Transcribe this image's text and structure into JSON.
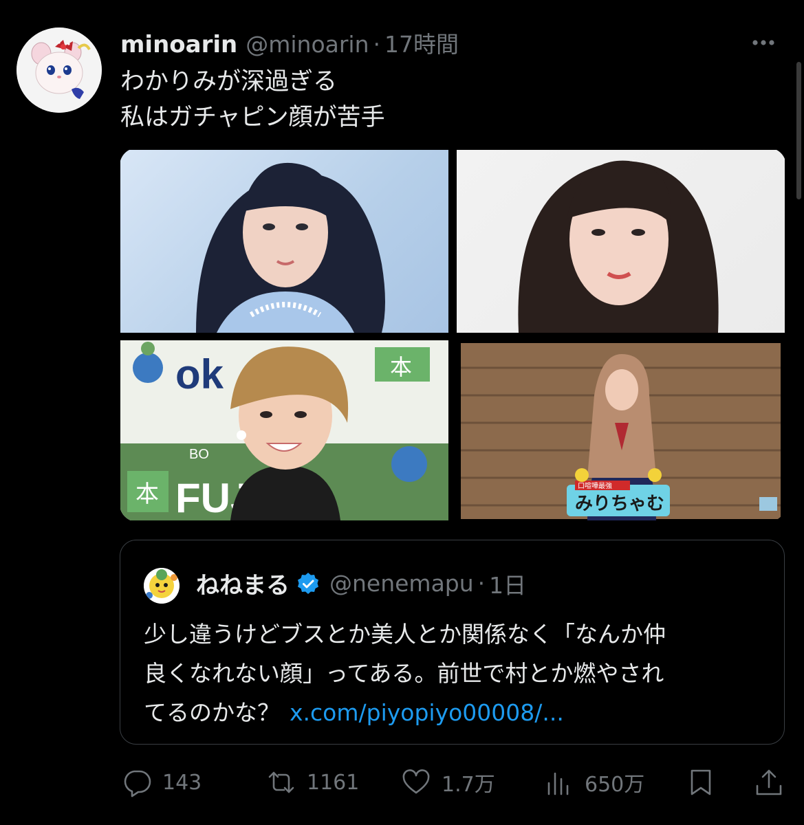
{
  "tweet": {
    "author_name": "minoarin",
    "author_handle": "@minoarin",
    "separator": "·",
    "time": "17時間",
    "text_lines": [
      "わかりみが深過ぎる",
      "私はガチャピン顔が苦手"
    ],
    "avatar_icon": "hamster-character-avatar",
    "more_icon": "more-options-icon"
  },
  "media": {
    "cells": [
      "photo-1",
      "photo-2",
      "photo-3",
      "photo-4"
    ],
    "overlay_texts": {
      "photo3_sign_top": "ok",
      "photo3_sign_bottom": "FUJ A",
      "photo3_books": "本",
      "photo3_small": "BO",
      "photo4_caption_small": "口喧嘩最強",
      "photo4_caption": "みりちゃむ"
    }
  },
  "quote": {
    "author_name": "ねねまる",
    "verified": true,
    "author_handle": "@nenemapu",
    "separator": "·",
    "time": "1日",
    "text_line1": "少し違うけどブスとか美人とか関係なく「なんか仲",
    "text_line2": "良くなれない顔」ってある。前世で村とか燃やされ",
    "text_line3": "てるのかな？",
    "link": "x.com/piyopiyo00008/..."
  },
  "actions": {
    "replies": "143",
    "retweets": "1161",
    "likes": "1.7万",
    "views": "650万"
  },
  "colors": {
    "background": "#000000",
    "text": "#e7e9ea",
    "secondary": "#71767b",
    "link": "#1d9bf0",
    "verified": "#1d9bf0"
  }
}
